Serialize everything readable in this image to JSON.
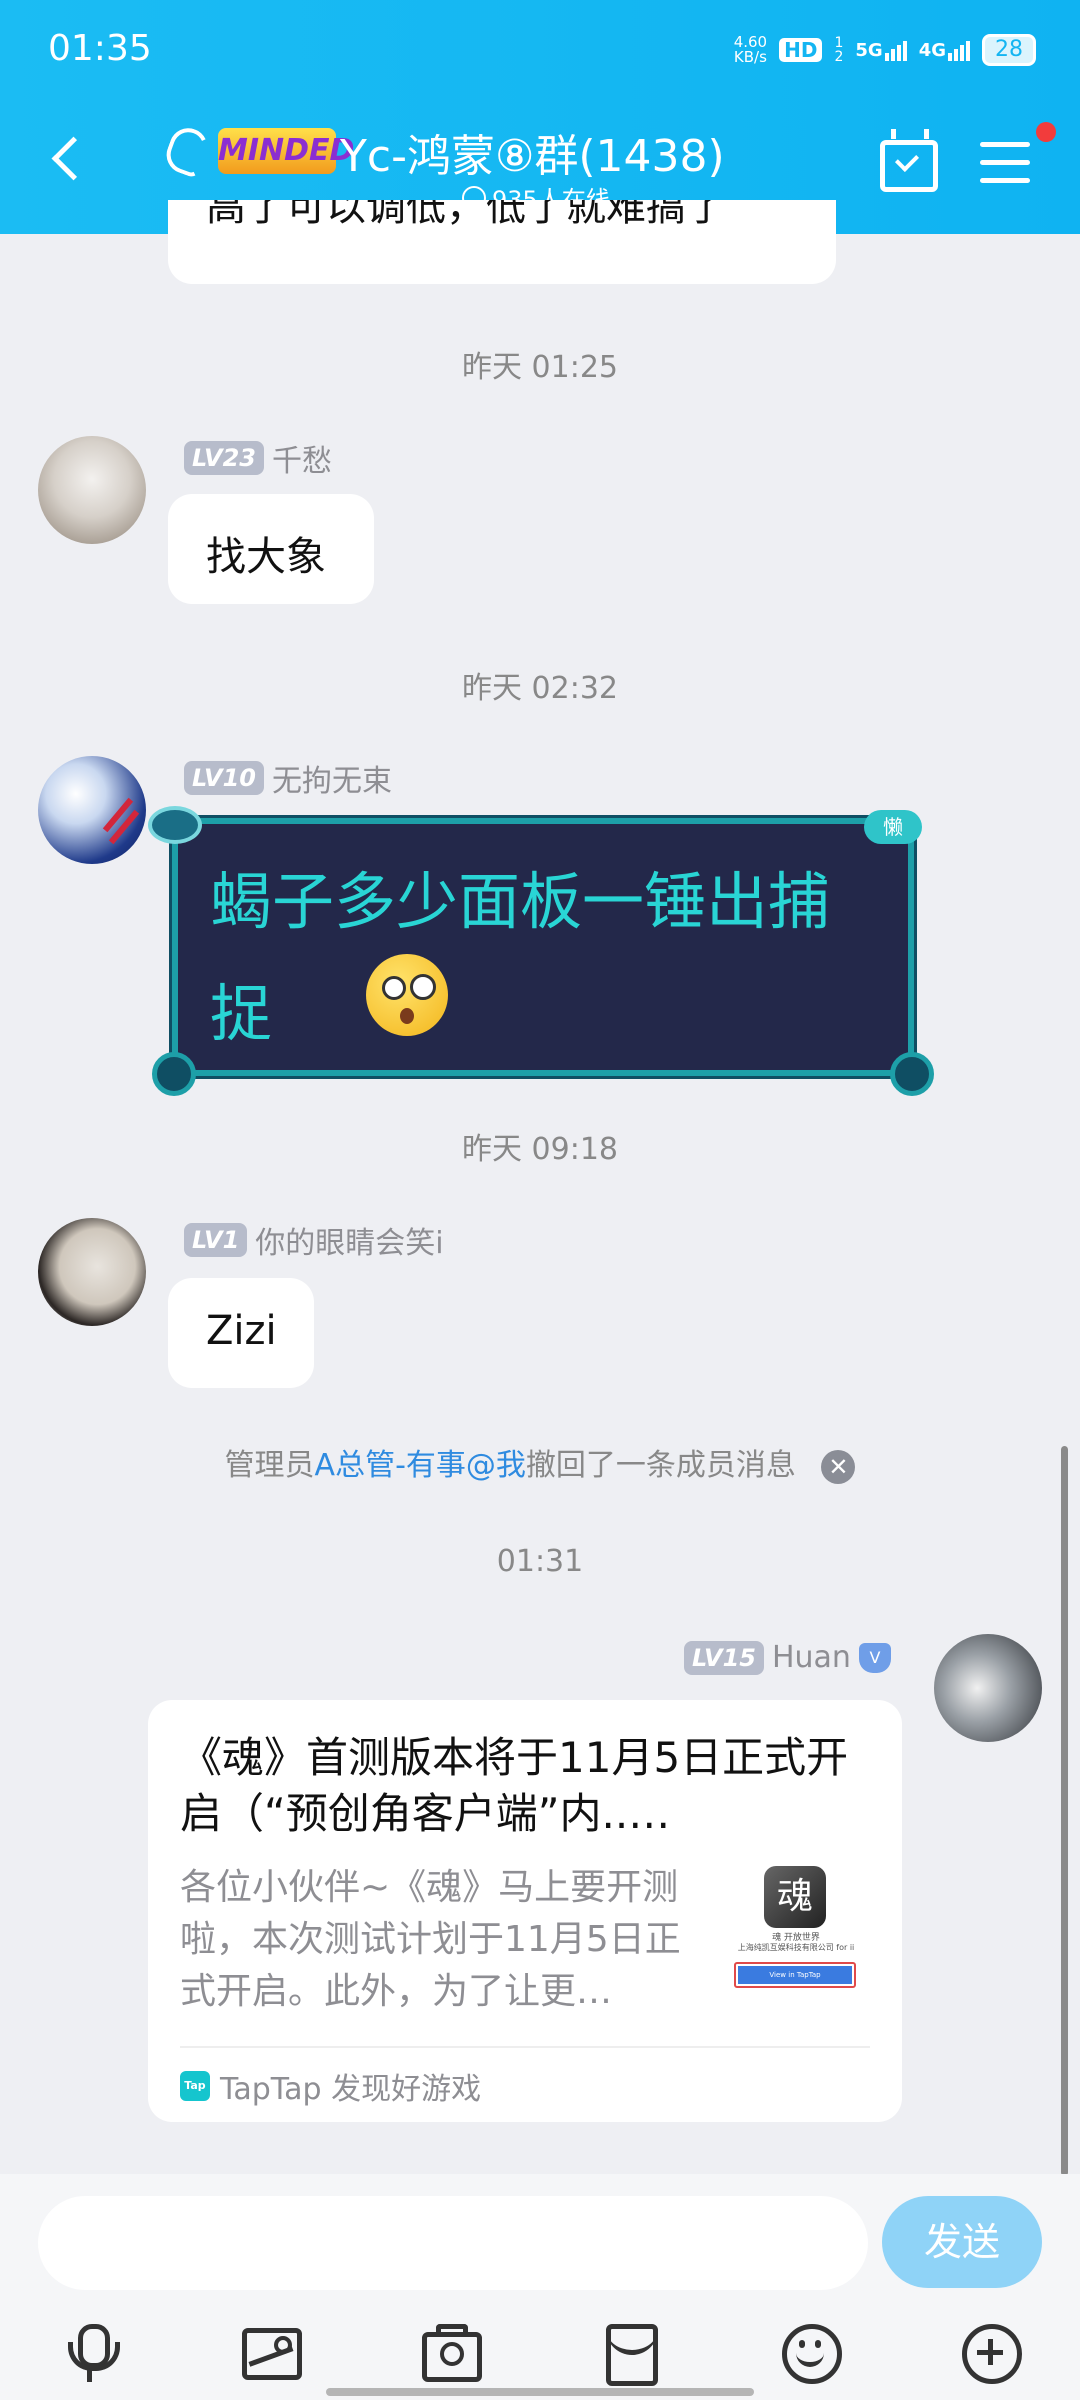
{
  "status_bar": {
    "time": "01:35",
    "net_speed": "4.60\nKB/s",
    "hd": "HD",
    "sim1": "1",
    "sim2": "2",
    "net1": "5G",
    "net2": "4G",
    "battery": "28"
  },
  "header": {
    "badge": "MINDED",
    "title": "Yc-鸿蒙⑧群(1438)",
    "online": "935人在线"
  },
  "chat": {
    "partial_top_text": "高了可以调低，低了就难搞了",
    "messages": [
      {
        "time": "昨天 01:25",
        "level": "LV23",
        "sender": "千愁",
        "text": "找大象"
      },
      {
        "time": "昨天 02:32",
        "level": "LV10",
        "sender": "无拘无束",
        "text": "蝎子多少面板一锤出捕捉",
        "frame_tag": "懒"
      },
      {
        "time": "昨天 09:18",
        "level": "LV1",
        "sender": "你的眼睛会笑i",
        "text": "Zizi"
      }
    ],
    "recall_notice": {
      "prefix": "管理员",
      "admin": "A总管-有事@我",
      "suffix": "撤回了一条成员消息"
    },
    "last_time": "01:31",
    "share": {
      "level": "LV15",
      "sender": "Huan",
      "title": "《魂》首测版本将于11月5日正式开启（“预创角客户端”内..…",
      "desc": "各位小伙伴~《魂》马上要开测啦，本次测试计划于11月5日正式开启。此外，为了让更…",
      "thumb_text1": "魂 开放世界",
      "thumb_text2": "上海纯凯互娱科技有限公司 for ii",
      "thumb_btn": "View in TapTap",
      "source_icon": "Tap",
      "source": "TapTap 发现好游戏"
    }
  },
  "input": {
    "placeholder": "",
    "send": "发送"
  },
  "colors": {
    "header": "#14b5f2",
    "link": "#2f8be0",
    "frame_text": "#29d5d5"
  }
}
